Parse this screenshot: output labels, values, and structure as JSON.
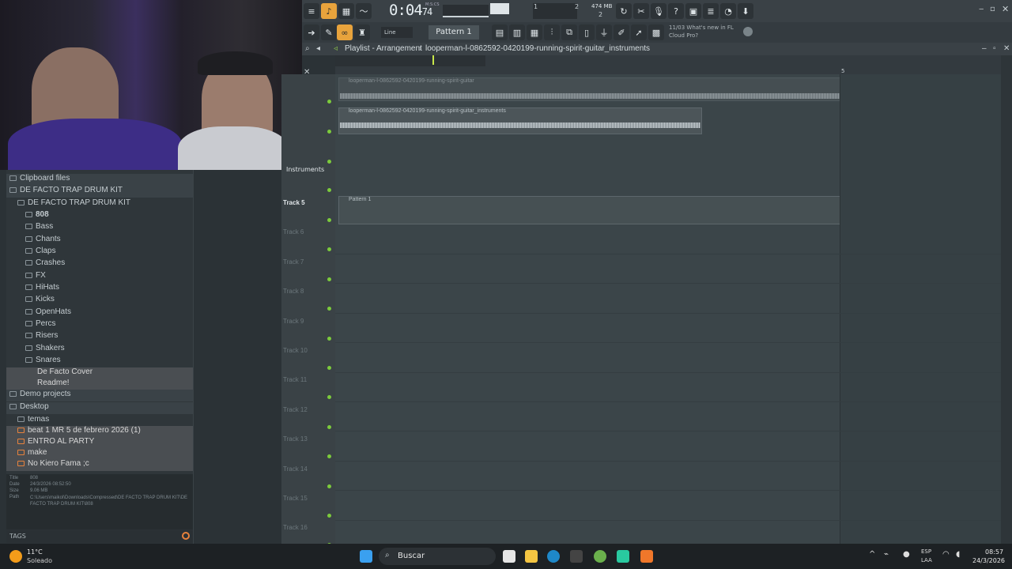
{
  "app": {
    "time": "0:04",
    "time_frac": "74",
    "time_label": "M:S:CS",
    "mem": "474 MB",
    "cpu_value": "2",
    "line_mode": "Line",
    "pattern": "Pattern 1",
    "news_line1": "11/03  What's new in FL",
    "news_line2": "Cloud Pro?",
    "pitch_values": [
      "1",
      "2",
      "2"
    ]
  },
  "playlist": {
    "title": "Playlist - Arrangement",
    "clip_path": "looperman-l-0862592-0420199-running-spirit-guitar_instruments",
    "ruler_marker": "5",
    "clip1_label": "looperman-l-0862592-0420199-running-spirit-guitar",
    "clip2_label": "looperman-l-0862592-0420199-running-spirit-guitar_instruments",
    "pattern_clip_label": "Pattern 1",
    "instruments_label": "Instruments",
    "tracks": [
      "Track 5",
      "Track 6",
      "Track 7",
      "Track 8",
      "Track 9",
      "Track 10",
      "Track 11",
      "Track 12",
      "Track 13",
      "Track 14",
      "Track 15",
      "Track 16"
    ]
  },
  "browser": {
    "items": [
      {
        "label": "Clipboard files",
        "indent": 0
      },
      {
        "label": "DE FACTO TRAP DRUM KIT",
        "indent": 0
      },
      {
        "label": "DE FACTO TRAP DRUM KIT",
        "indent": 1
      },
      {
        "label": "808",
        "indent": 2,
        "bold": true
      },
      {
        "label": "Bass",
        "indent": 2
      },
      {
        "label": "Chants",
        "indent": 2
      },
      {
        "label": "Claps",
        "indent": 2
      },
      {
        "label": "Crashes",
        "indent": 2
      },
      {
        "label": "FX",
        "indent": 2
      },
      {
        "label": "HiHats",
        "indent": 2
      },
      {
        "label": "Kicks",
        "indent": 2
      },
      {
        "label": "OpenHats",
        "indent": 2
      },
      {
        "label": "Percs",
        "indent": 2
      },
      {
        "label": "Risers",
        "indent": 2
      },
      {
        "label": "Shakers",
        "indent": 2
      },
      {
        "label": "Snares",
        "indent": 2
      }
    ],
    "files": [
      "De Facto Cover",
      "Readme!"
    ],
    "demo": "Demo projects",
    "desktop": "Desktop",
    "temas": "temas",
    "desktop_files": [
      "beat 1 MR 5 de febrero 2026 (1)",
      "ENTRO AL PARTY",
      "make",
      "No Kiero Fama ;c"
    ],
    "info": {
      "title_label": "Title",
      "title_val": "808",
      "date_label": "Date",
      "date_val": "24/3/2026 08:52:50",
      "size_label": "Size",
      "size_val": "9.06 MB",
      "path_label": "Path",
      "path_val": "C:\\Users\\maikol\\Downloads\\Compressed\\DE FACTO TRAP DRUM KIT\\DE FACTO TRAP DRUM KIT\\808"
    },
    "tags": "TAGS"
  },
  "taskbar": {
    "temp": "11°C",
    "weather": "Soleado",
    "search": "Buscar",
    "lang1": "ESP",
    "lang2": "LAA",
    "clock": "08:57",
    "date": "24/3/2026"
  }
}
